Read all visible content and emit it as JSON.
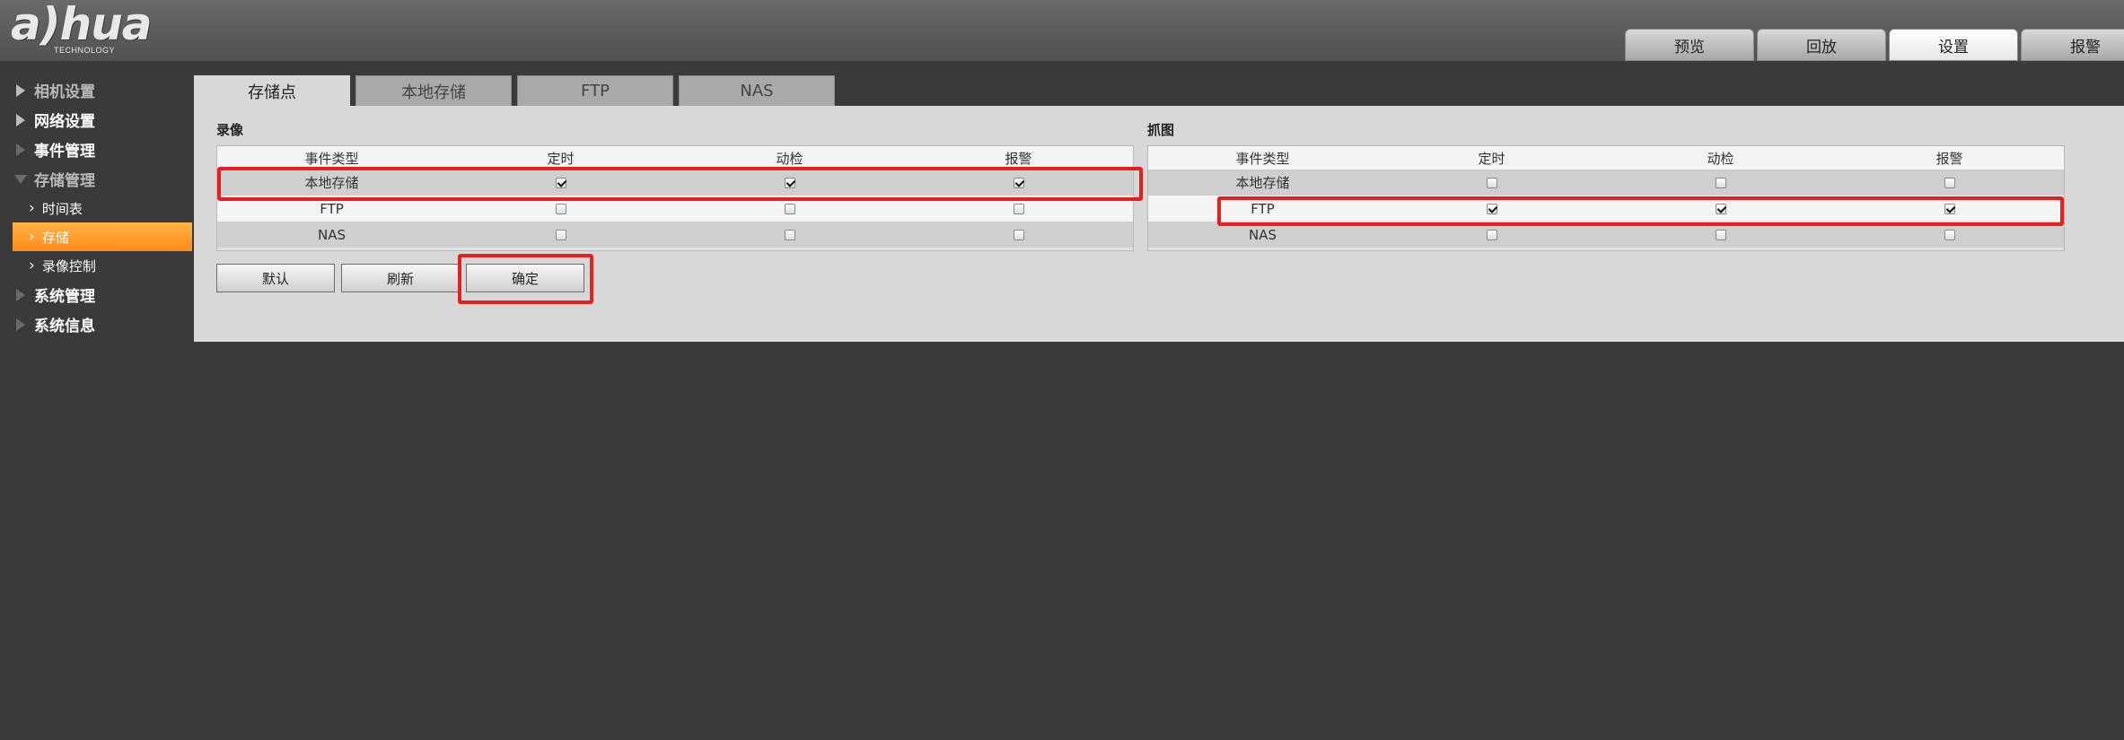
{
  "header": {
    "logo_text": "a)hua",
    "logo_sub": "TECHNOLOGY",
    "tabs": [
      {
        "label": "预览"
      },
      {
        "label": "回放"
      },
      {
        "label": "设置"
      },
      {
        "label": "报警"
      }
    ],
    "active_tab": "设置"
  },
  "sidebar": {
    "groups": [
      {
        "label": "相机设置"
      },
      {
        "label": "网络设置"
      },
      {
        "label": "事件管理"
      },
      {
        "label": "存储管理"
      },
      {
        "label": "系统管理"
      },
      {
        "label": "系统信息"
      }
    ],
    "storage_sub": [
      {
        "label": "时间表"
      },
      {
        "label": "存储"
      },
      {
        "label": "录像控制"
      }
    ],
    "active_sub": "存储"
  },
  "content": {
    "tabs": [
      {
        "label": "存储点"
      },
      {
        "label": "本地存储"
      },
      {
        "label": "FTP"
      },
      {
        "label": "NAS"
      }
    ],
    "active_tab": "存储点",
    "record": {
      "title": "录像",
      "headers": [
        "事件类型",
        "定时",
        "动检",
        "报警"
      ],
      "rows": [
        {
          "name": "本地存储",
          "timed": true,
          "motion": true,
          "alarm": true
        },
        {
          "name": "FTP",
          "timed": false,
          "motion": false,
          "alarm": false
        },
        {
          "name": "NAS",
          "timed": false,
          "motion": false,
          "alarm": false
        }
      ]
    },
    "snapshot": {
      "title": "抓图",
      "headers": [
        "事件类型",
        "定时",
        "动检",
        "报警"
      ],
      "rows": [
        {
          "name": "本地存储",
          "timed": false,
          "motion": false,
          "alarm": false
        },
        {
          "name": "FTP",
          "timed": true,
          "motion": true,
          "alarm": true
        },
        {
          "name": "NAS",
          "timed": false,
          "motion": false,
          "alarm": false
        }
      ]
    },
    "buttons": {
      "default": "默认",
      "refresh": "刷新",
      "confirm": "确定"
    }
  },
  "colors": {
    "highlight": "#e8201d",
    "active_sidebar": "#ff9a2e",
    "background": "#3a3a3a",
    "panel": "#d8d8d8"
  }
}
